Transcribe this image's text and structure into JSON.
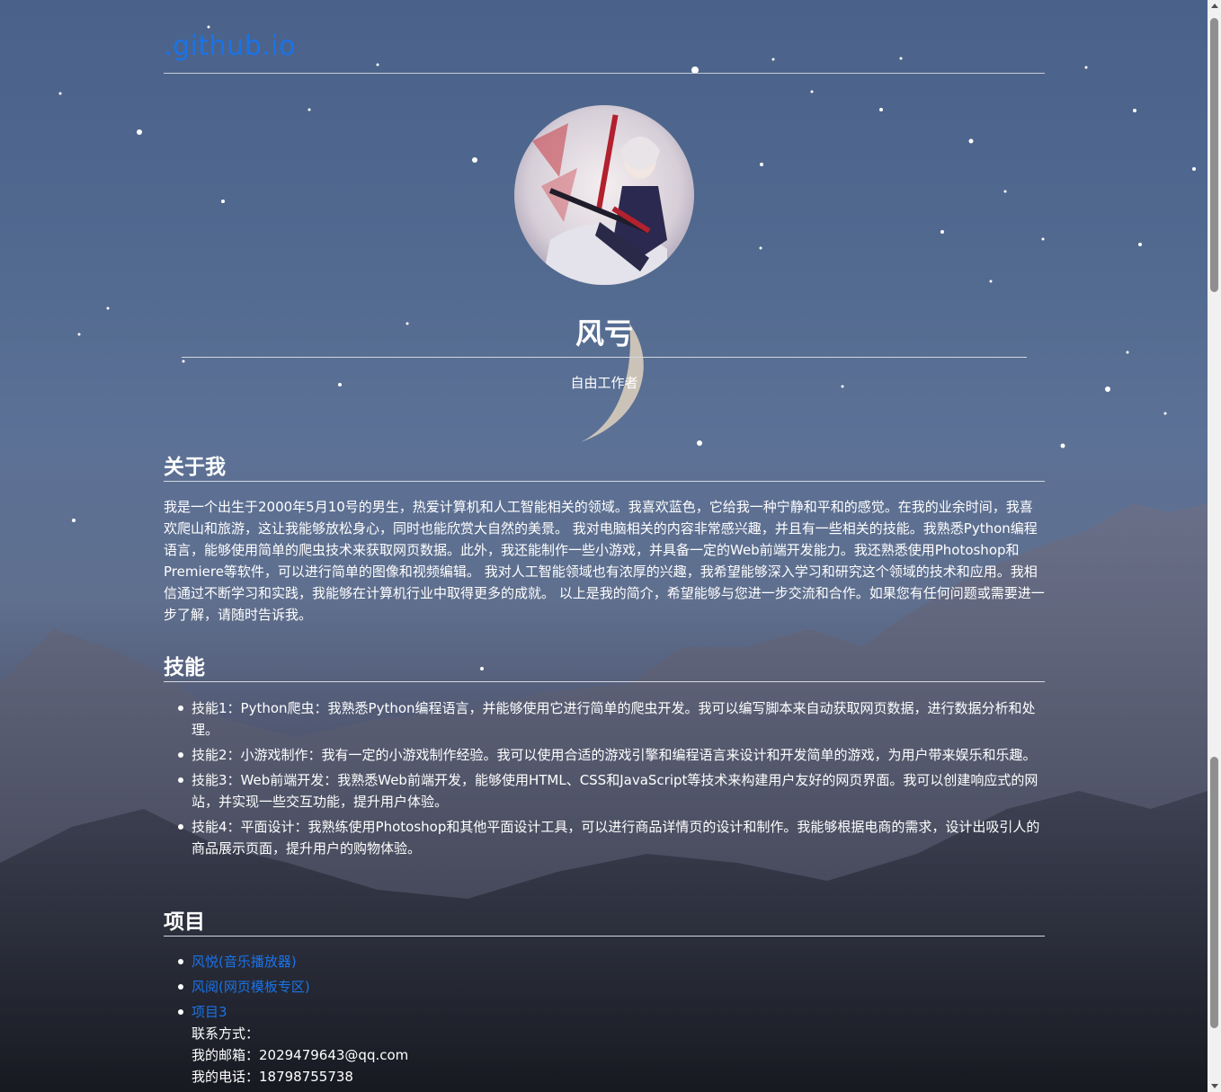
{
  "site": {
    "title": ".github.io"
  },
  "profile": {
    "name": "风亏",
    "subtitle": "自由工作者"
  },
  "about": {
    "heading": "关于我",
    "text": "我是一个出生于2000年5月10号的男生，热爱计算机和人工智能相关的领域。我喜欢蓝色，它给我一种宁静和平和的感觉。在我的业余时间，我喜欢爬山和旅游，这让我能够放松身心，同时也能欣赏大自然的美景。 我对电脑相关的内容非常感兴趣，并且有一些相关的技能。我熟悉Python编程语言，能够使用简单的爬虫技术来获取网页数据。此外，我还能制作一些小游戏，并具备一定的Web前端开发能力。我还熟悉使用Photoshop和Premiere等软件，可以进行简单的图像和视频编辑。 我对人工智能领域也有浓厚的兴趣，我希望能够深入学习和研究这个领域的技术和应用。我相信通过不断学习和实践，我能够在计算机行业中取得更多的成就。 以上是我的简介，希望能够与您进一步交流和合作。如果您有任何问题或需要进一步了解，请随时告诉我。"
  },
  "skills": {
    "heading": "技能",
    "items": [
      "技能1：Python爬虫：我熟悉Python编程语言，并能够使用它进行简单的爬虫开发。我可以编写脚本来自动获取网页数据，进行数据分析和处理。",
      "技能2：小游戏制作：我有一定的小游戏制作经验。我可以使用合适的游戏引擎和编程语言来设计和开发简单的游戏，为用户带来娱乐和乐趣。",
      "技能3：Web前端开发：我熟悉Web前端开发，能够使用HTML、CSS和JavaScript等技术来构建用户友好的网页界面。我可以创建响应式的网站，并实现一些交互功能，提升用户体验。",
      "技能4：平面设计：我熟练使用Photoshop和其他平面设计工具，可以进行商品详情页的设计和制作。我能够根据电商的需求，设计出吸引人的商品展示页面，提升用户的购物体验。"
    ]
  },
  "projects": {
    "heading": "项目",
    "items": [
      "风悦(音乐播放器)",
      "风阅(网页模板专区)",
      "项目3"
    ]
  },
  "contact": {
    "label": "联系方式：",
    "email": "我的邮箱：2029479643@qq.com",
    "phone": "我的电话：18798755738"
  },
  "colors": {
    "link": "#1a73e8",
    "text": "#ffffff",
    "divider": "#d5d8de"
  }
}
